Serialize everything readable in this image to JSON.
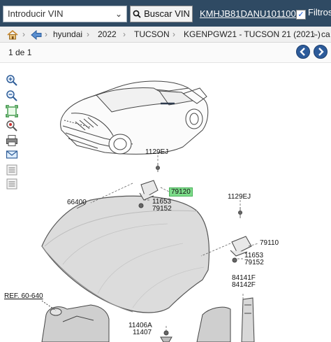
{
  "topbar": {
    "vin_select_value": "Introducir VIN",
    "search_button_label": "Buscar VIN",
    "vin_link": "KMHJB81DANU101100",
    "filters_label": "Filtros"
  },
  "breadcrumb": {
    "items": [
      "hyundai",
      "2022",
      "TUCSON",
      "KGENPGW21 - TUCSON 21 (2021-)",
      "ca"
    ]
  },
  "pager": {
    "label": "1 de 1"
  },
  "toolbar": {
    "tools": [
      "zoom-in-icon",
      "zoom-out-icon",
      "fit-icon",
      "locate-icon",
      "print-icon",
      "email-icon",
      "list-icon",
      "list-icon"
    ]
  },
  "diagram": {
    "labels": {
      "l1129ej_a": "1129EJ",
      "l79120": "79120",
      "l66400": "66400",
      "l11653_a": "11653",
      "l79152_a": "79152",
      "l1129ej_b": "1129EJ",
      "l79110": "79110",
      "l11653_b": "11653",
      "l79152_b": "79152",
      "lref": "REF. 60-640",
      "l84141f": "84141F",
      "l84142f": "84142F",
      "l11406a": "11406A",
      "l11407": "11407"
    },
    "highlight_color": "#7ddc8a"
  }
}
